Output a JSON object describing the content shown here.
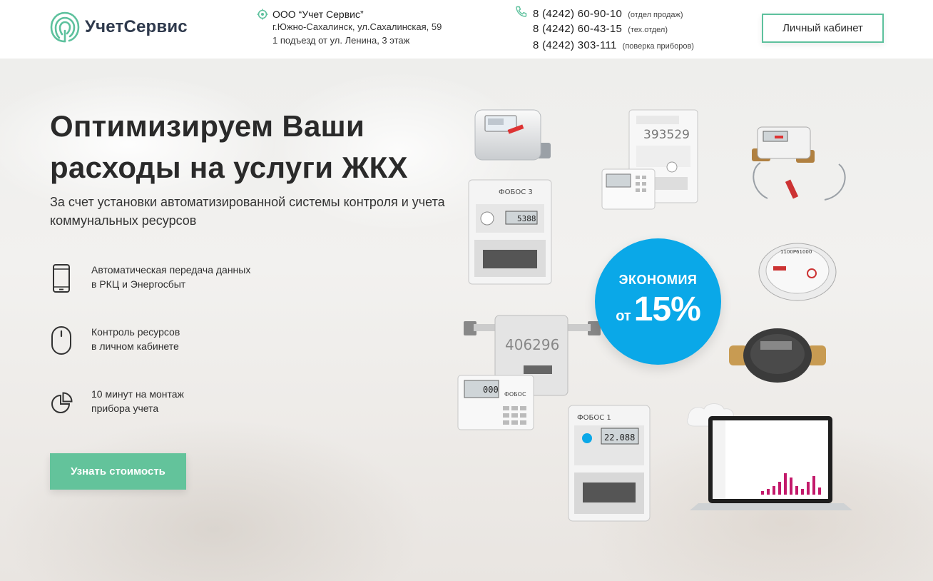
{
  "header": {
    "brand": "УчетСервис",
    "company": "ООО “Учет Сервис”",
    "address_line1": "г.Южно-Сахалинск, ул.Сахалинская, 59",
    "address_line2": "1 подъезд от ул. Ленина, 3 этаж",
    "phones": [
      {
        "number": "8 (4242) 60-90-10",
        "note": "(отдел продаж)"
      },
      {
        "number": "8 (4242) 60-43-15",
        "note": "(тех.отдел)"
      },
      {
        "number": "8 (4242) 303-111",
        "note": "(поверка приборов)"
      }
    ],
    "cabinet_label": "Личный кабинет"
  },
  "hero": {
    "title_line1": "Оптимизируем Ваши",
    "title_line2": "расходы на услуги ЖКХ",
    "subtitle": "За счет установки автоматизированной системы контроля и учета коммунальных ресурсов",
    "features": [
      {
        "icon": "smartphone-icon",
        "line1": "Автоматическая передача данных",
        "line2": "в РКЦ и Энергосбыт"
      },
      {
        "icon": "mouse-icon",
        "line1": "Контроль ресурсов",
        "line2": "в личном кабинете"
      },
      {
        "icon": "pie-chart-icon",
        "line1": "10 минут на монтаж",
        "line2": "прибора учета"
      }
    ],
    "cta_label": "Узнать стоимость",
    "badge": {
      "label": "ЭКОНОМИЯ",
      "from": "от",
      "value": "15%"
    },
    "device_labels": {
      "meter_top": "393529",
      "meter_left_brand": "ФОБОС 3",
      "meter_left_reading": "5388",
      "flow_meter_number": "406296",
      "display_brand": "ФОБОС",
      "display_reading": "000",
      "meter_bottom_brand": "ФОБОС 1",
      "meter_bottom_reading": "22.088",
      "water_meter_number": "1100Р61000"
    }
  },
  "colors": {
    "accent": "#5dc19d",
    "cta": "#63c39b",
    "badge": "#0aa8e8",
    "text": "#2a2a2a"
  }
}
